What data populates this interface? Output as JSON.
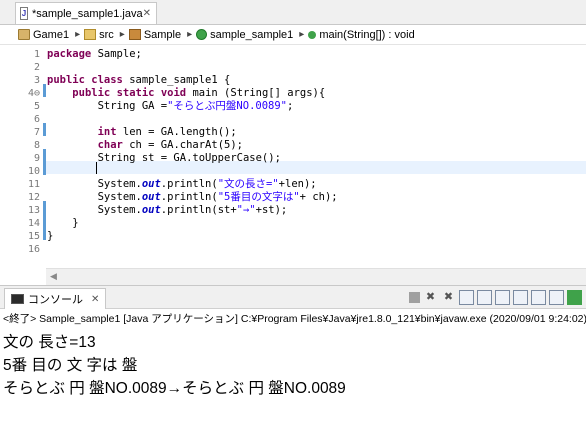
{
  "editor_tab": {
    "title": "*sample_sample1.java",
    "close": "✕"
  },
  "breadcrumb": {
    "items": [
      {
        "label": "Game1",
        "icon": "project-icon"
      },
      {
        "label": "src",
        "icon": "folder-icon"
      },
      {
        "label": "Sample",
        "icon": "package-icon"
      },
      {
        "label": "sample_sample1",
        "icon": "class-icon"
      },
      {
        "label": "main(String[]) : void",
        "icon": "method-icon"
      }
    ]
  },
  "code_lines": [
    {
      "n": "1",
      "text": "package Sample;"
    },
    {
      "n": "2",
      "text": ""
    },
    {
      "n": "3",
      "text": "public class sample_sample1 {"
    },
    {
      "n": "4⊖",
      "text": "    public static void main (String[] args){"
    },
    {
      "n": "5",
      "text": "        String GA =\"そらとぶ円盤NO.0089\";"
    },
    {
      "n": "6",
      "text": ""
    },
    {
      "n": "7",
      "text": "        int len = GA.length();"
    },
    {
      "n": "8",
      "text": "        char ch = GA.charAt(5);"
    },
    {
      "n": "9",
      "text": "        String st = GA.toUpperCase();"
    },
    {
      "n": "10",
      "text": ""
    },
    {
      "n": "11",
      "text": "        System.out.println(\"文の長さ=\"+len);"
    },
    {
      "n": "12",
      "text": "        System.out.println(\"5番目の文字は\"+ ch);"
    },
    {
      "n": "13",
      "text": "        System.out.println(st+\"→\"+st);"
    },
    {
      "n": "14",
      "text": "    }"
    },
    {
      "n": "15",
      "text": "}"
    },
    {
      "n": "16",
      "text": ""
    }
  ],
  "console": {
    "tab_title": "コンソール",
    "close": "✕",
    "status": "<終了> Sample_sample1 [Java アプリケーション] C:¥Program Files¥Java¥jre1.8.0_121¥bin¥javaw.exe (2020/09/01 9:24:02)",
    "output": [
      "文の 長さ=13",
      "5番 目の 文 字は 盤",
      "そらとぶ 円 盤NO.0089→そらとぶ 円 盤NO.0089"
    ]
  },
  "colors": {
    "keyword": "#7f0055",
    "string": "#2a00ff",
    "field": "#0000c0",
    "current_line": "#e8f2fe",
    "change_bar": "#5b9bd5"
  }
}
